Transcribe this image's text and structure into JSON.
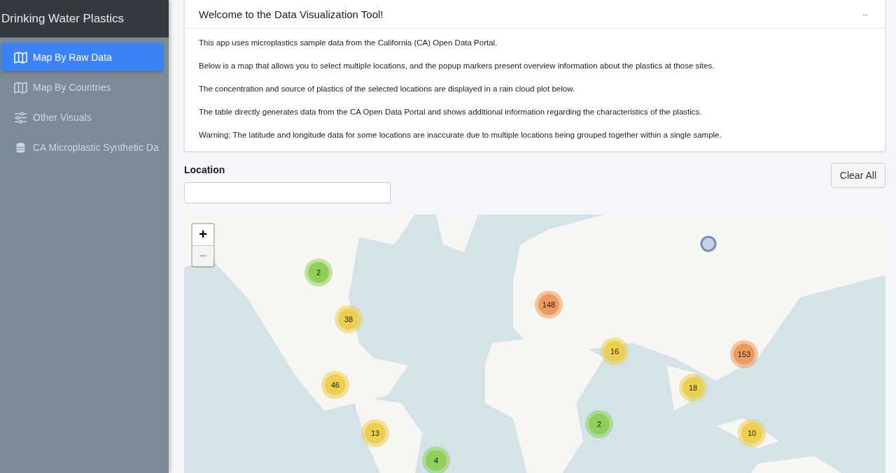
{
  "sidebar": {
    "title": "Drinking Water Plastics",
    "items": [
      {
        "label": "Map By Raw Data",
        "selected": true
      },
      {
        "label": "Map By Countries",
        "selected": false
      },
      {
        "label": "Other Visuals",
        "selected": false
      },
      {
        "label": "CA Microplastic Synthetic Da",
        "selected": false
      }
    ]
  },
  "welcome_card": {
    "title": "Welcome to the Data Visualization Tool!",
    "collapse_symbol": "–",
    "paragraphs": [
      "This app uses microplastics sample data from the California (CA) Open Data Portal.",
      "Below is a map that allows you to select multiple locations, and the popup markers present overview information about the plastics at those sites.",
      "The concentration and source of plastics of the selected locations are displayed in a rain cloud plot below.",
      "The table directly generates data from the CA Open Data Portal and shows additional information regarding the characteristics of the plastics.",
      "Warning: The latitude and longitude data for some locations are inaccurate due to multiple locations being grouped together within a single sample."
    ]
  },
  "location": {
    "label": "Location",
    "clear_button": "Clear All"
  },
  "map": {
    "zoom_in": {
      "label": "+",
      "disabled": false
    },
    "zoom_out": {
      "label": "−",
      "disabled": true
    },
    "clusters": [
      {
        "count": "2",
        "color": "#8fcf5a"
      },
      {
        "count": "38",
        "color": "#edcf4f"
      },
      {
        "count": "46",
        "color": "#edcf4f"
      },
      {
        "count": "13",
        "color": "#edcf4f"
      },
      {
        "count": "4",
        "color": "#8fcf5a"
      },
      {
        "count": "148",
        "color": "#ec9a5c"
      },
      {
        "count": "16",
        "color": "#edcf4f"
      },
      {
        "count": "153",
        "color": "#ec9a5c"
      },
      {
        "count": "18",
        "color": "#edcf4f"
      },
      {
        "count": "2",
        "color": "#8fcf5a"
      },
      {
        "count": "10",
        "color": "#edcf4f"
      }
    ]
  }
}
